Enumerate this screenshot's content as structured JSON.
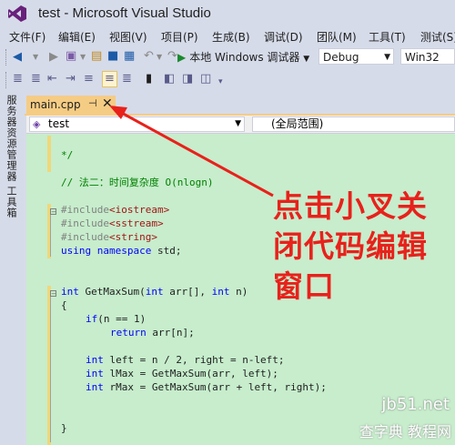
{
  "window": {
    "title": "test - Microsoft Visual Studio"
  },
  "menu": [
    "文件(F)",
    "编辑(E)",
    "视图(V)",
    "项目(P)",
    "生成(B)",
    "调试(D)",
    "团队(M)",
    "工具(T)",
    "测试(S)"
  ],
  "toolbar": {
    "run_label": "本地 Windows 调试器",
    "config": "Debug",
    "platform": "Win32"
  },
  "side_tabs": [
    "服务器资源管理器",
    "工具箱"
  ],
  "document_tab": {
    "label": "main.cpp",
    "pin_glyph": "⊣",
    "close_glyph": "✕"
  },
  "navbar": {
    "project": "test",
    "scope": "(全局范围)"
  },
  "code_lines": [
    "*/",
    "// 法二：时间复杂度 O(nlogn)",
    "#include<iostream>",
    "#include<sstream>",
    "#include<string>",
    "using namespace std;",
    "int GetMaxSum(int arr[], int n)",
    "{",
    "if(n == 1)",
    "return arr[n];",
    "int left = n / 2, right = n-left;",
    "int lMax = GetMaxSum(arr, left);",
    "int rMax = GetMaxSum(arr + left, right);",
    "}"
  ],
  "annotation": {
    "line1": "点击小叉关",
    "line2": "闭代码编辑",
    "line3": "窗口",
    "color": "#e8211b"
  },
  "watermark": {
    "top": "jb51.net",
    "bottom": "查字典 教程网"
  }
}
